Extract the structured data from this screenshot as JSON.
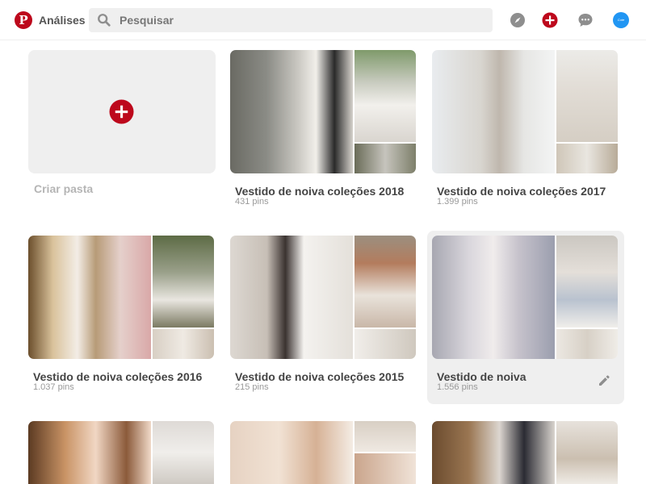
{
  "header": {
    "logo": "P",
    "title": "Análises",
    "search": {
      "placeholder": "Pesquisar",
      "value": ""
    },
    "avatar_text": "Cute",
    "icons": [
      "compass-icon",
      "add-icon",
      "message-icon"
    ]
  },
  "create_board": {
    "label": "Criar pasta"
  },
  "boards": [
    {
      "title": "Vestido de noiva coleções 2018",
      "count": "431 pins"
    },
    {
      "title": "Vestido de noiva coleções 2017",
      "count": "1.399 pins"
    },
    {
      "title": "Vestido de noiva coleções 2016",
      "count": "1.037 pins"
    },
    {
      "title": "Vestido de noiva coleções 2015",
      "count": "215 pins"
    },
    {
      "title": "Vestido de noiva",
      "count": "1.556 pins"
    }
  ],
  "colors": {
    "brand": "#bd081c",
    "avatar": "#2196f3",
    "surface": "#efefef"
  }
}
